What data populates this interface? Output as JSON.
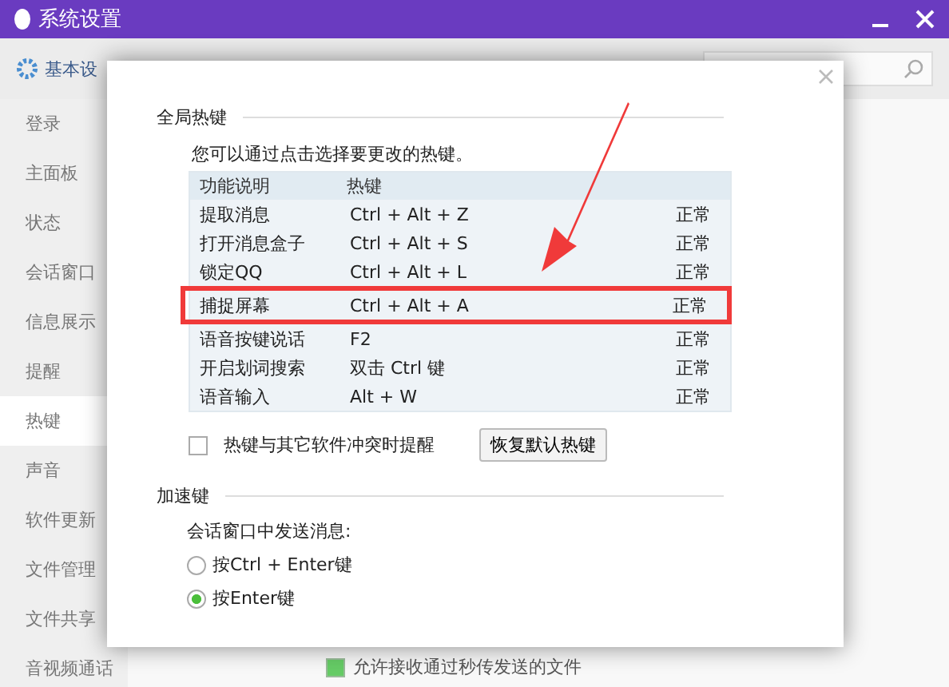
{
  "window": {
    "title": "系统设置"
  },
  "toolbar": {
    "tabs": [
      {
        "label": "基本设",
        "selected": true
      }
    ]
  },
  "sidebar": {
    "items": [
      {
        "label": "登录",
        "selected": false
      },
      {
        "label": "主面板",
        "selected": false
      },
      {
        "label": "状态",
        "selected": false
      },
      {
        "label": "会话窗口",
        "selected": false
      },
      {
        "label": "信息展示",
        "selected": false
      },
      {
        "label": "提醒",
        "selected": false
      },
      {
        "label": "热键",
        "selected": true
      },
      {
        "label": "声音",
        "selected": false
      },
      {
        "label": "软件更新",
        "selected": false
      },
      {
        "label": "文件管理",
        "selected": false
      },
      {
        "label": "文件共享",
        "selected": false
      },
      {
        "label": "音视频通话",
        "selected": false
      }
    ]
  },
  "background_option": {
    "label": "允许接收通过秒传发送的文件",
    "checked": true
  },
  "dialog": {
    "global_section": {
      "title": "全局热键",
      "description": "您可以通过点击选择要更改的热键。",
      "columns": [
        "功能说明",
        "热键"
      ],
      "rows": [
        {
          "function": "提取消息",
          "hotkey": "Ctrl + Alt + Z",
          "status": "正常",
          "highlighted": false
        },
        {
          "function": "打开消息盒子",
          "hotkey": "Ctrl + Alt + S",
          "status": "正常",
          "highlighted": false
        },
        {
          "function": "锁定QQ",
          "hotkey": "Ctrl + Alt + L",
          "status": "正常",
          "highlighted": false
        },
        {
          "function": "捕捉屏幕",
          "hotkey": "Ctrl + Alt + A",
          "status": "正常",
          "highlighted": true
        },
        {
          "function": "语音按键说话",
          "hotkey": "F2",
          "status": "正常",
          "highlighted": false
        },
        {
          "function": "开启划词搜索",
          "hotkey": "双击 Ctrl 键",
          "status": "正常",
          "highlighted": false
        },
        {
          "function": "语音输入",
          "hotkey": "Alt + W",
          "status": "正常",
          "highlighted": false
        }
      ],
      "conflict_check": {
        "label": "热键与其它软件冲突时提醒",
        "checked": false
      },
      "restore_button": "恢复默认热键"
    },
    "accel_section": {
      "title": "加速键",
      "prompt": "会话窗口中发送消息:",
      "options": [
        {
          "label": "按Ctrl + Enter键",
          "selected": false
        },
        {
          "label": "按Enter键",
          "selected": true
        }
      ]
    }
  }
}
